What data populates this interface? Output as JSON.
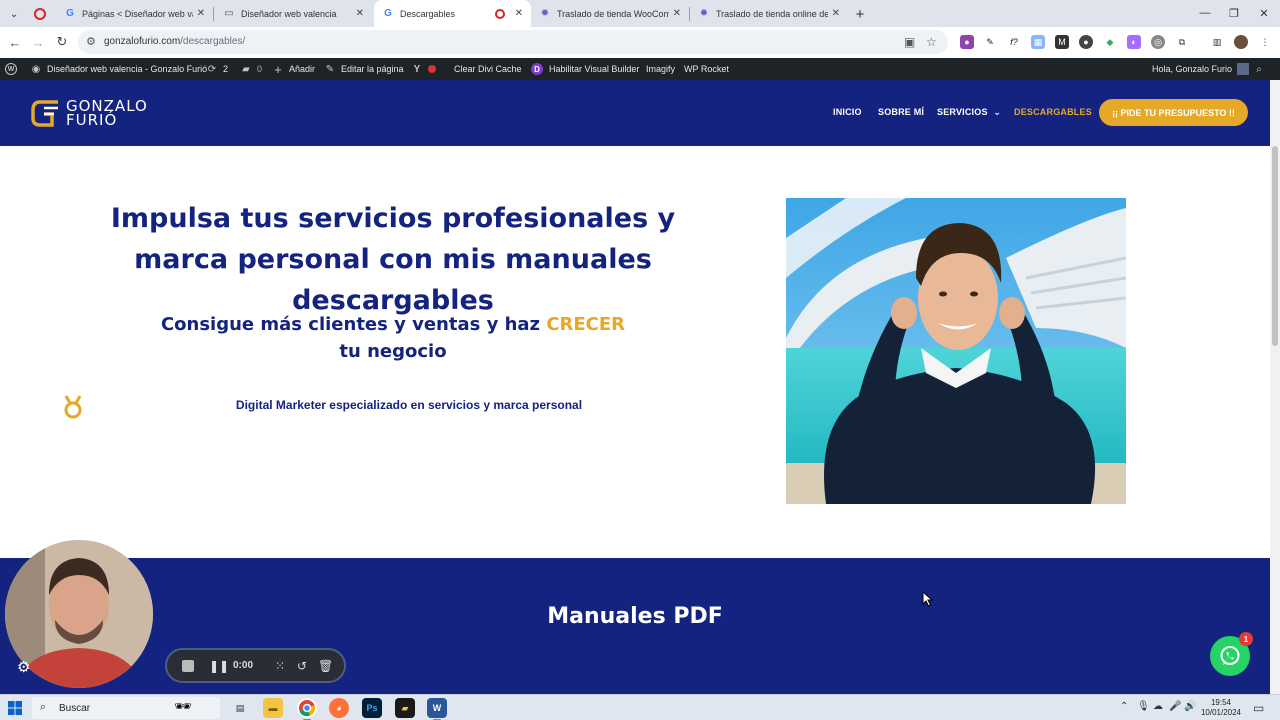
{
  "browser": {
    "tabs": [
      {
        "title": "Páginas < Diseñador web valencia",
        "active": false
      },
      {
        "title": "Diseñador web valencia",
        "active": false
      },
      {
        "title": "Descargables",
        "active": true
      },
      {
        "title": "Traslado de tienda WooCommerce",
        "active": false
      },
      {
        "title": "Traslado de tienda online de m",
        "active": false
      }
    ],
    "url_host": "gonzalofurio.com",
    "url_path": "/descargables/"
  },
  "wpbar": {
    "site_name": "Diseñador web valencia - Gonzalo Furió",
    "updates_count": "2",
    "comments_count": "0",
    "add_label": "Añadir",
    "edit_label": "Editar la página",
    "clear_cache_label": "Clear Divi Cache",
    "visual_builder_label": "Habilitar Visual Builder",
    "imagify_label": "Imagify",
    "rocket_label": "WP Rocket",
    "greeting": "Hola, Gonzalo Furio"
  },
  "header": {
    "logo_line1": "GONZALO",
    "logo_line2": "FURIÓ",
    "menu": {
      "inicio": "INICIO",
      "sobre": "SOBRE MÍ",
      "servicios": "SERVICIOS",
      "descargables": "DESCARGABLES"
    },
    "cta": "¡¡ PIDE TU PRESUPUESTO !!"
  },
  "hero": {
    "title": "Impulsa tus servicios profesionales y marca personal con mis manuales descargables",
    "subtitle_before": "Consigue más clientes y ventas y haz ",
    "subtitle_accent": "CRECER",
    "subtitle_after": " tu negocio",
    "tagline": "Digital Marketer especializado en servicios y marca personal"
  },
  "pdf_section": {
    "title": "Manuales PDF"
  },
  "recorder": {
    "timer": "0:00"
  },
  "whatsapp": {
    "badge": "1"
  },
  "taskbar": {
    "search_placeholder": "Buscar",
    "time": "19:54",
    "date": "10/01/2024"
  },
  "colors": {
    "brand_navy": "#14237f",
    "brand_gold": "#e5a827",
    "whatsapp_green": "#25d366"
  }
}
